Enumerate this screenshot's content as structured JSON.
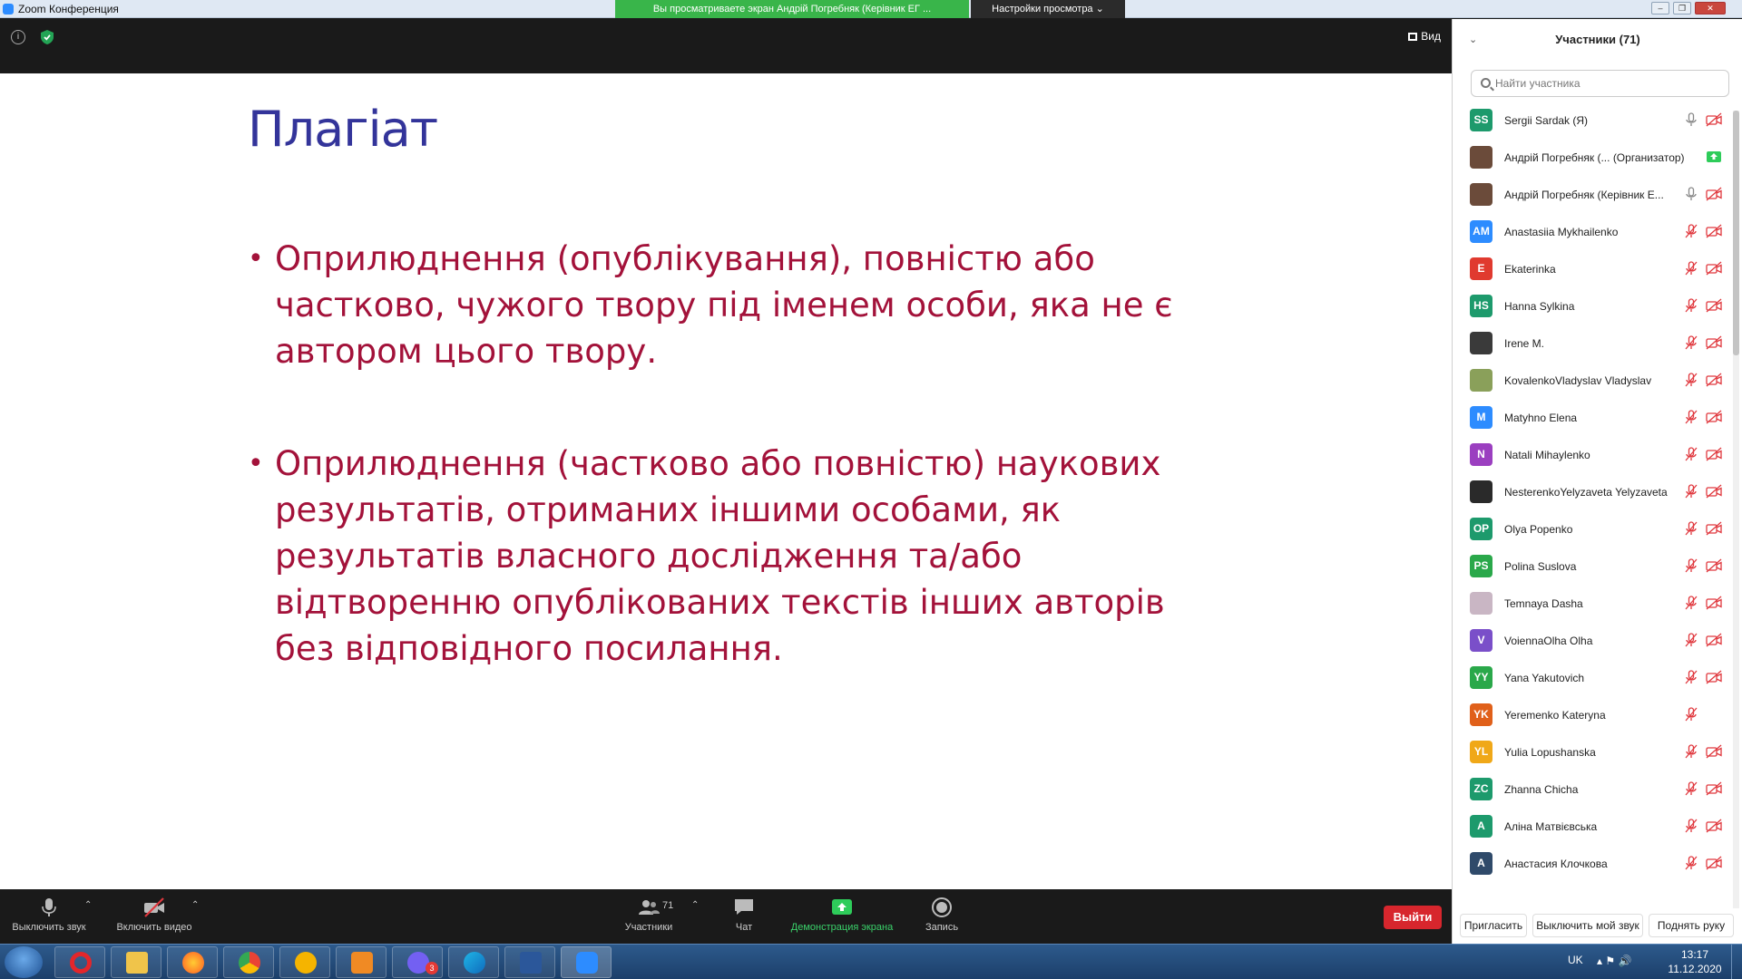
{
  "titlebar": {
    "title": "Zoom Конференция",
    "share_banner": "Вы просматриваете экран Андрій Погребняк (Керівник ЕГ ...",
    "view_settings": "Настройки просмотра ⌄"
  },
  "topstrip": {
    "view_label": "Вид"
  },
  "slide": {
    "title": "Плагіат",
    "bullets": [
      " Оприлюднення (опублікування),  повністю   або частково,  чужого  твору під іменем особи,  яка не є автором цього твору.",
      " Оприлюднення (частково або повністю) наукових результатів, отриманих іншими особами, як результатів власного дослідження та/або відтворенню опублікованих текстів інших авторів без відповідного посилання."
    ]
  },
  "toolbar": {
    "mute": "Выключить звук",
    "video": "Включить видео",
    "participants": "Участники",
    "participants_count": "71",
    "chat": "Чат",
    "share": "Демонстрация экрана",
    "record": "Запись",
    "leave": "Выйти"
  },
  "panel": {
    "title": "Участники (71)",
    "search_placeholder": "Найти участника",
    "participants": [
      {
        "initials": "SS",
        "name": "Sergii Sardak (Я)",
        "color": "#1d9a6c",
        "mic": "on",
        "cam": "off"
      },
      {
        "initials": "",
        "name": "Андрій Погребняк (...  (Организатор)",
        "color": "#6b4b3a",
        "mic": "none",
        "cam": "share"
      },
      {
        "initials": "",
        "name": "Андрій Погребняк (Керівник Е...",
        "color": "#6b4b3a",
        "mic": "on",
        "cam": "off"
      },
      {
        "initials": "AM",
        "name": "Anastasiia Mykhailenko",
        "color": "#2d8cff",
        "mic": "off",
        "cam": "off"
      },
      {
        "initials": "E",
        "name": "Ekaterinka",
        "color": "#e03a2f",
        "mic": "off",
        "cam": "off"
      },
      {
        "initials": "HS",
        "name": "Hanna Sylkina",
        "color": "#1d9a6c",
        "mic": "off",
        "cam": "off"
      },
      {
        "initials": "",
        "name": "Irene M.",
        "color": "#3a3a3a",
        "mic": "off",
        "cam": "off"
      },
      {
        "initials": "",
        "name": "KovalenkoVladyslav Vladyslav",
        "color": "#8aa05a",
        "mic": "off",
        "cam": "off"
      },
      {
        "initials": "M",
        "name": "Matyhno Elena",
        "color": "#2d8cff",
        "mic": "off",
        "cam": "off"
      },
      {
        "initials": "N",
        "name": "Natali Mihaylenko",
        "color": "#9b3fc0",
        "mic": "off",
        "cam": "off"
      },
      {
        "initials": "",
        "name": "NesterenkoYelyzaveta Yelyzaveta",
        "color": "#2a2a2a",
        "mic": "off",
        "cam": "off"
      },
      {
        "initials": "OP",
        "name": "Olya Popenko",
        "color": "#1d9a6c",
        "mic": "off",
        "cam": "off"
      },
      {
        "initials": "PS",
        "name": "Polina Suslova",
        "color": "#2aa84a",
        "mic": "off",
        "cam": "off"
      },
      {
        "initials": "",
        "name": "Temnaya Dasha",
        "color": "#c9b6c4",
        "mic": "off",
        "cam": "off"
      },
      {
        "initials": "V",
        "name": "VoiennaOlha Olha",
        "color": "#7a4fc9",
        "mic": "off",
        "cam": "off"
      },
      {
        "initials": "YY",
        "name": "Yana Yakutovich",
        "color": "#2aa84a",
        "mic": "off",
        "cam": "off"
      },
      {
        "initials": "YK",
        "name": "Yeremenko Kateryna",
        "color": "#e0601a",
        "mic": "off",
        "cam": "none"
      },
      {
        "initials": "YL",
        "name": "Yulia Lopushanska",
        "color": "#f0a818",
        "mic": "off",
        "cam": "off"
      },
      {
        "initials": "ZC",
        "name": "Zhanna Chicha",
        "color": "#1d9a6c",
        "mic": "off",
        "cam": "off"
      },
      {
        "initials": "А",
        "name": "Аліна Матвієвська",
        "color": "#1d9a6c",
        "mic": "off",
        "cam": "off"
      },
      {
        "initials": "А",
        "name": "Анастасия Клочкова",
        "color": "#2f4a6a",
        "mic": "off",
        "cam": "off"
      }
    ],
    "footer": {
      "invite": "Пригласить",
      "mute_me": "Выключить мой звук",
      "raise_hand": "Поднять руку"
    }
  },
  "taskbar": {
    "lang": "UK",
    "time": "13:17",
    "date": "11.12.2020",
    "viber_badge": "3"
  }
}
